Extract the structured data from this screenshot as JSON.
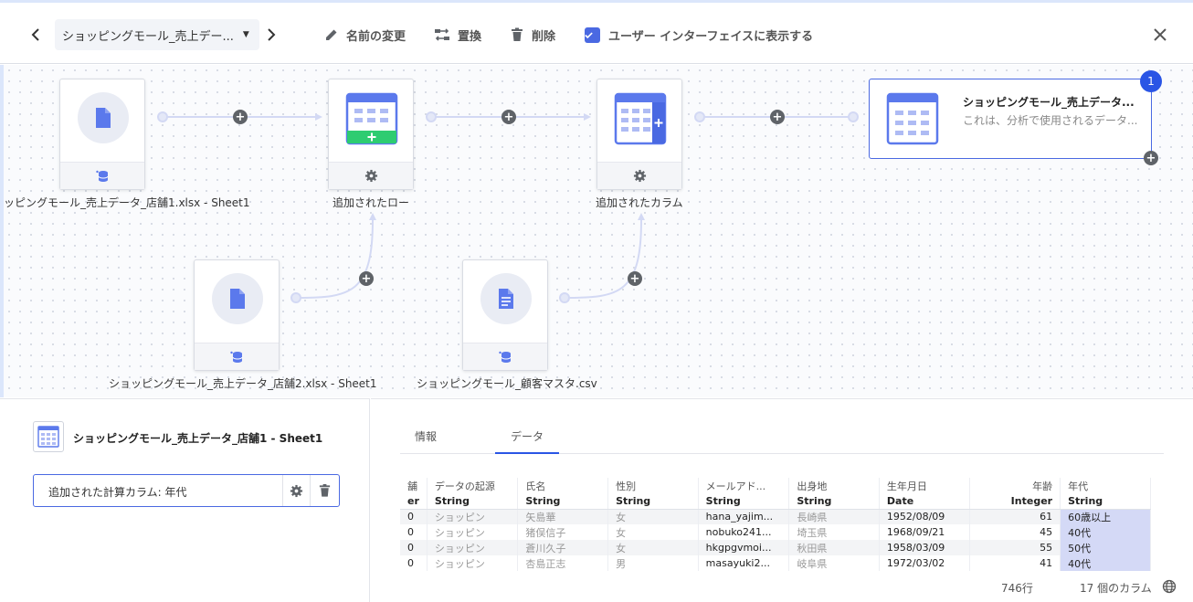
{
  "toolbar": {
    "dataset_name": "ショッピングモール_売上デー...",
    "rename_label": "名前の変更",
    "replace_label": "置換",
    "delete_label": "削除",
    "show_ui_label": "ユーザー インターフェイスに表示する",
    "show_ui_checked": true
  },
  "canvas": {
    "nodes": {
      "source1_label": "ッピングモール_売上データ_店舗1.xlsx - Sheet1",
      "added_rows_label": "追加されたロー",
      "added_columns_label": "追加されたカラム",
      "source2_label": "ショッピングモール_売上データ_店舗2.xlsx - Sheet1",
      "source3_label": "ショッピングモール_顧客マスタ.csv"
    },
    "output": {
      "title": "ショッピングモール_売上データ...",
      "description": "これは、分析で使用されるデータ...",
      "badge": "1"
    }
  },
  "left_panel": {
    "title": "ショッピングモール_売上データ_店舗1 - Sheet1",
    "step_label": "追加された計算カラム: 年代"
  },
  "right_panel": {
    "tabs": [
      "情報",
      "データ"
    ],
    "active_tab": "データ",
    "columns": [
      {
        "name": "舗",
        "type": "er"
      },
      {
        "name": "データの起源",
        "type": "String"
      },
      {
        "name": "氏名",
        "type": "String"
      },
      {
        "name": "性別",
        "type": "String"
      },
      {
        "name": "メールアド...",
        "type": "String"
      },
      {
        "name": "出身地",
        "type": "String"
      },
      {
        "name": "生年月日",
        "type": "Date"
      },
      {
        "name": "年齢",
        "type": "Integer"
      },
      {
        "name": "年代",
        "type": "String"
      }
    ],
    "rows": [
      [
        "0",
        "ショッピン",
        "矢島華",
        "女",
        "hana_yajim...",
        "長崎県",
        "1952/08/09",
        "61",
        "60歳以上"
      ],
      [
        "0",
        "ショッピン",
        "猪俣信子",
        "女",
        "nobuko241...",
        "埼玉県",
        "1968/09/21",
        "45",
        "40代"
      ],
      [
        "0",
        "ショッピン",
        "蒼川久子",
        "女",
        "hkgpgvmoi...",
        "秋田県",
        "1958/03/09",
        "55",
        "50代"
      ],
      [
        "0",
        "ショッピン",
        "杏島正志",
        "男",
        "masayuki2...",
        "岐阜県",
        "1972/03/02",
        "41",
        "40代"
      ]
    ],
    "row_count": "746行",
    "column_count": "17 個のカラム"
  },
  "colors": {
    "accent": "#2a55e5",
    "node_icon": "#5b79ec",
    "green": "#2ecc71",
    "highlight": "#d4d9f6"
  }
}
